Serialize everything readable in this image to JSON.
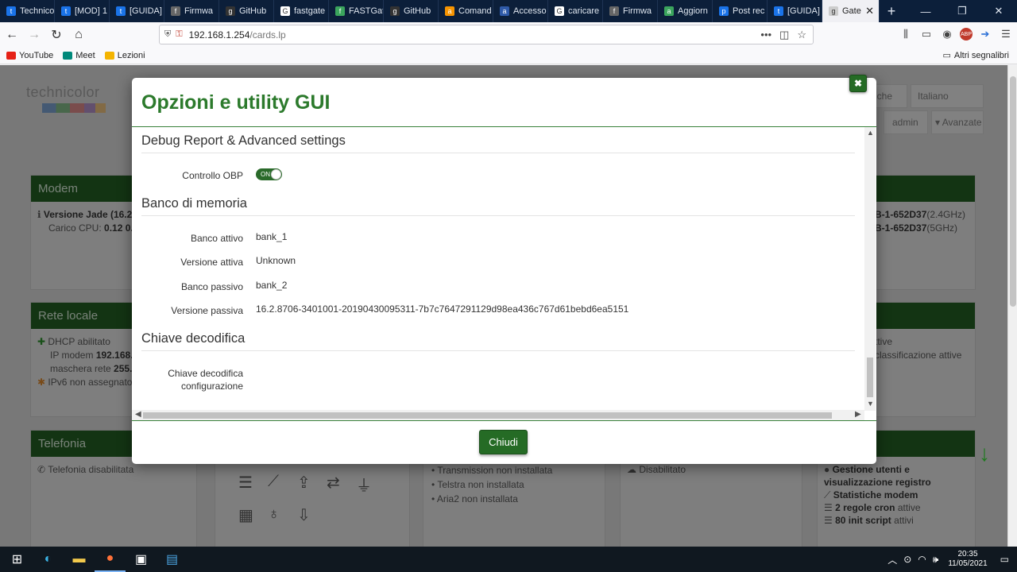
{
  "browser": {
    "tabs": [
      {
        "label": "Technico",
        "color": "#1a73e8",
        "icon": "t"
      },
      {
        "label": "[MOD] 1",
        "color": "#1a73e8",
        "icon": "t"
      },
      {
        "label": "[GUIDA]",
        "color": "#1a73e8",
        "icon": "t"
      },
      {
        "label": "Firmwa",
        "color": "#666666",
        "icon": "f"
      },
      {
        "label": "GitHub",
        "color": "#333333",
        "icon": "g"
      },
      {
        "label": "fastgate",
        "color": "#ffffff",
        "icon": "G"
      },
      {
        "label": "FASTGat",
        "color": "#3ba55d",
        "icon": "f"
      },
      {
        "label": "GitHub",
        "color": "#333333",
        "icon": "g"
      },
      {
        "label": "Comand",
        "color": "#f79400",
        "icon": "a"
      },
      {
        "label": "Accesso",
        "color": "#2f5aa8",
        "icon": "a"
      },
      {
        "label": "caricare",
        "color": "#ffffff",
        "icon": "G"
      },
      {
        "label": "Firmwa",
        "color": "#666666",
        "icon": "f"
      },
      {
        "label": "Aggiorn",
        "color": "#3ba55d",
        "icon": "a"
      },
      {
        "label": "Post rec",
        "color": "#1a73e8",
        "icon": "p"
      },
      {
        "label": "[GUIDA]",
        "color": "#1a73e8",
        "icon": "t"
      },
      {
        "label": "Gate",
        "color": "#cccccc",
        "icon": "g",
        "active": true
      }
    ],
    "url_host": "192.168.1.254",
    "url_path": "/cards.lp",
    "bookmarks": [
      {
        "label": "YouTube",
        "color": "#e62117"
      },
      {
        "label": "Meet",
        "color": "#00897b"
      },
      {
        "label": "Lezioni",
        "color": "#f4b400"
      }
    ],
    "other_bookmarks": "Altri segnalibri"
  },
  "background": {
    "logo": "technicolor",
    "header_boxes": {
      "box1": "iche",
      "box2": "Italiano",
      "box3": "admin",
      "box4": "▾ Avanzate"
    },
    "cards": {
      "modem": {
        "title": "Modem",
        "line1": "Versione Jade (16.2",
        "line2": "Carico CPU:",
        "line2b": "0.12 0."
      },
      "wifi_right": {
        "line1": "B-1-652D37",
        "line1b": "(2.4GHz)",
        "line2": "B-1-652D37",
        "line2b": "(5GHz)"
      },
      "rete_locale": {
        "title": "Rete locale",
        "line1": "DHCP abilitato",
        "line2": "IP modem",
        "line2b": "192.168.",
        "line3": "maschera rete",
        "line3b": "255.",
        "line4": "IPv6 non assegnato"
      },
      "right2": {
        "line1": "ttive",
        "line2": "classificazione attive"
      },
      "telefonia": {
        "title": "Telefonia",
        "line1": "Telefonia disabilitata"
      },
      "downloads": {
        "line1": "Transmission non installata",
        "line2": "Telstra non installata",
        "line3": "Aria2 non installata"
      },
      "disabled_card": {
        "line1": "Disabilitato"
      },
      "mgmt": {
        "line1": "Gestione utenti e visualizzazione registro",
        "line2": "Statistiche modem",
        "line3a": "2 regole cron",
        "line3b": "attive",
        "line4a": "80 init script",
        "line4b": "attivi"
      }
    }
  },
  "modal": {
    "title": "Opzioni e utility GUI",
    "sections": {
      "debug": {
        "title": "Debug Report & Advanced settings",
        "obp_label": "Controllo OBP",
        "obp_state": "ON"
      },
      "memory": {
        "title": "Banco di memoria",
        "active_bank_label": "Banco attivo",
        "active_bank_value": "bank_1",
        "active_version_label": "Versione attiva",
        "active_version_value": "Unknown",
        "passive_bank_label": "Banco passivo",
        "passive_bank_value": "bank_2",
        "passive_version_label": "Versione passiva",
        "passive_version_value": "16.2.8706-3401001-20190430095311-7b7c7647291129d98ea436c767d61bebd6ea5151"
      },
      "decode": {
        "title": "Chiave decodifica",
        "config_key_label_1": "Chiave decodifica",
        "config_key_label_2": "configurazione"
      }
    },
    "close_button": "Chiudi"
  },
  "taskbar": {
    "time": "20:35",
    "date": "11/05/2021"
  }
}
